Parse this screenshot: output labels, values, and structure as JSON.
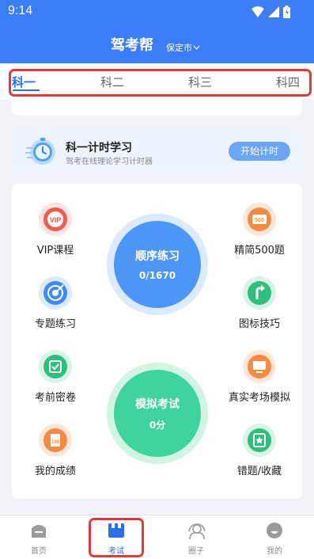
{
  "status": {
    "time": "9:14"
  },
  "header": {
    "title": "驾考帮",
    "city": "保定市"
  },
  "tabs": [
    {
      "label": "科一",
      "active": true
    },
    {
      "label": "科二",
      "active": false
    },
    {
      "label": "科三",
      "active": false
    },
    {
      "label": "科四",
      "active": false
    }
  ],
  "timer": {
    "title": "科一计时学习",
    "subtitle": "驾考在线理论学习计时器",
    "button": "开始计时"
  },
  "features": {
    "vip": "VIP课程",
    "topic": "专题练习",
    "mock_paper": "考前密卷",
    "scores": "我的成绩",
    "select500": "精简500题",
    "sign_tips": "图标技巧",
    "real_exam": "真实考场模拟",
    "mistakes": "错题/收藏"
  },
  "practice": {
    "title": "顺序练习",
    "progress": "0/1670"
  },
  "mock": {
    "title": "模拟考试",
    "score": "0分"
  },
  "bottom_nav": [
    {
      "label": "首页",
      "icon": "home-icon",
      "active": false
    },
    {
      "label": "考试",
      "icon": "exam-icon",
      "active": true
    },
    {
      "label": "圈子",
      "icon": "community-icon",
      "active": false
    },
    {
      "label": "我的",
      "icon": "profile-icon",
      "active": false
    }
  ],
  "colors": {
    "primary": "#3a7df6",
    "active_tab": "#2a6ff0",
    "highlight": "#e53935"
  }
}
